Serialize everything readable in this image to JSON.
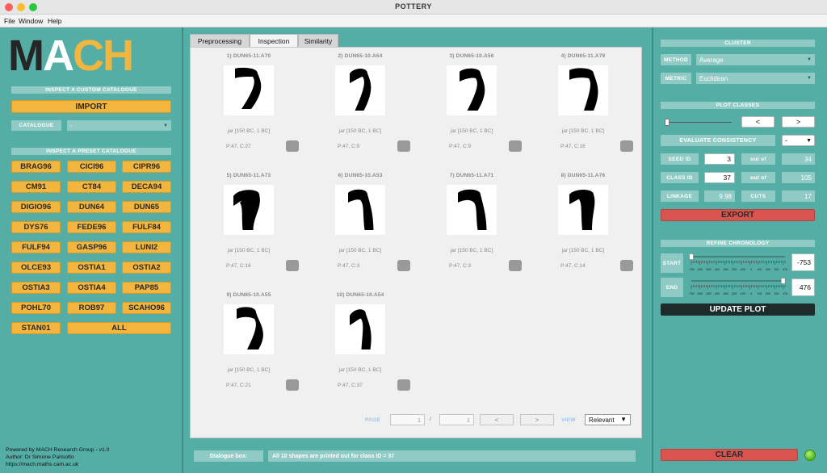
{
  "window": {
    "title": "POTTERY"
  },
  "menu": [
    "File",
    "Window",
    "Help"
  ],
  "logo": {
    "m": "M",
    "a": "A",
    "c": "C",
    "h": "H"
  },
  "left": {
    "custom_header": "INSPECT A CUSTOM CATALOGUE",
    "import_label": "IMPORT",
    "catalogue_label": "CATALOGUE",
    "catalogue_value": "-",
    "preset_header": "INSPECT A PRESET CATALOGUE",
    "presets": [
      "BRAG96",
      "CICI96",
      "CIPR96",
      "CM91",
      "CT84",
      "DECA94",
      "DIGIO96",
      "DUN64",
      "DUN65",
      "DYS76",
      "FEDE96",
      "FULF84",
      "FULF94",
      "GASP96",
      "LUNI2",
      "OLCE93",
      "OSTIA1",
      "OSTIA2",
      "OSTIA3",
      "OSTIA4",
      "PAP85",
      "POHL70",
      "ROB97",
      "SCAHO96",
      "STAN01"
    ],
    "all_label": "ALL",
    "credits": [
      "Powered by MACH Research Group - v1.0",
      "Author: Dr Simone Parisotto",
      "https://mach.maths.cam.ac.uk"
    ]
  },
  "center": {
    "tabs": [
      "Preprocessing",
      "Inspection",
      "Similarity"
    ],
    "active_tab": 1,
    "shapes": [
      {
        "title": "1) DUN65-11.A70",
        "type": "jar [150 BC, 1 BC]",
        "pc": "P:47, C:27"
      },
      {
        "title": "2) DUN65-10.A64",
        "type": "jar [150 BC, 1 BC]",
        "pc": "P:47, C:9"
      },
      {
        "title": "3) DUN65-10.A56",
        "type": "jar [150 BC, 1 BC]",
        "pc": "P:47, C:9"
      },
      {
        "title": "4) DUN65-11.A79",
        "type": "jar [150 BC, 1 BC]",
        "pc": "P:47, C:16"
      },
      {
        "title": "5) DUN65-11.A73",
        "type": "jar [150 BC, 1 BC]",
        "pc": "P:47, C:16"
      },
      {
        "title": "6) DUN65-10.A53",
        "type": "jar [150 BC, 1 BC]",
        "pc": "P:47, C:3"
      },
      {
        "title": "7) DUN65-11.A71",
        "type": "jar [150 BC, 1 BC]",
        "pc": "P:47, C:3"
      },
      {
        "title": "8) DUN65-11.A76",
        "type": "jar [150 BC, 1 BC]",
        "pc": "P:47, C:14"
      },
      {
        "title": "9) DUN65-10.A55",
        "type": "jar [150 BC, 1 BC]",
        "pc": "P:47, C:21"
      },
      {
        "title": "10) DUN65-10.A54",
        "type": "jar [150 BC, 1 BC]",
        "pc": "P:47, C:37"
      }
    ],
    "pager": {
      "page_label": "PAGE",
      "page": "1",
      "sep": "/",
      "total": "1",
      "prev": "<",
      "next": ">",
      "view_label": "VIEW",
      "view_value": "Relevant"
    },
    "dialogue": {
      "label": "Dialogue box:",
      "text": "All 10 shapes are printed out for class ID = 37"
    }
  },
  "right": {
    "cluster_header": "CLUSTER",
    "method_label": "METHOD",
    "method_value": "Average",
    "metric_label": "METRIC",
    "metric_value": "Euclidean",
    "plot_header": "PLOT CLASSES",
    "prev": "<",
    "next": ">",
    "evaluate_label": "EVALUATE CONSISTENCY",
    "evaluate_value": "-",
    "seed_label": "SEED ID",
    "seed_value": "3",
    "seed_outof_label": "out of",
    "seed_outof": "34",
    "class_label": "CLASS ID",
    "class_value": "37",
    "class_outof_label": "out of",
    "class_outof": "105",
    "linkage_label": "LINKAGE",
    "linkage_value": "9.98",
    "cuts_label": "CUTS",
    "cuts_value": "17",
    "export_label": "EXPORT",
    "refine_header": "REFINE CHRONOLOGY",
    "start_label": "START",
    "start_value": "-753",
    "end_label": "END",
    "end_value": "476",
    "ruler_ticks": [
      "-753",
      "-600",
      "-500",
      "-400",
      "-300",
      "-200",
      "-100",
      "0",
      "100",
      "200",
      "300",
      "476"
    ],
    "update_label": "UPDATE PLOT",
    "clear_label": "CLEAR"
  },
  "colors": {
    "accent_orange": "#f2b53e",
    "panel_teal": "#54aea6",
    "export_red": "#d9534f",
    "status_green": "#53b61c"
  }
}
